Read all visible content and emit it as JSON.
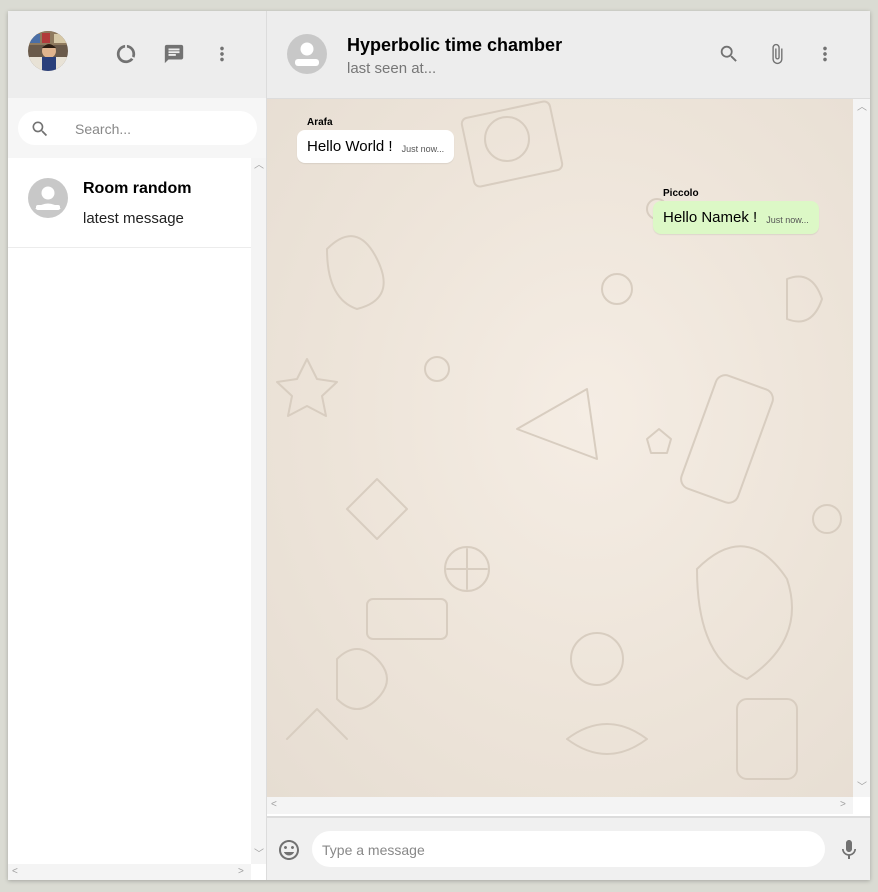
{
  "sidebar": {
    "header": {
      "user_avatar": "user-photo",
      "icons": [
        "status-icon",
        "chat-icon",
        "more-vert-icon"
      ]
    },
    "search": {
      "placeholder": "Search..."
    },
    "chats": [
      {
        "title": "Room random",
        "last_message": "latest message",
        "avatar": "person-icon"
      }
    ]
  },
  "main": {
    "header": {
      "title": "Hyperbolic time chamber",
      "subtitle": "last seen at...",
      "icons": [
        "search-icon",
        "attach-icon",
        "more-vert-icon"
      ]
    },
    "messages": [
      {
        "sender": "Arafa",
        "text": "Hello World !",
        "time": "Just now...",
        "mine": false
      },
      {
        "sender": "Piccolo",
        "text": "Hello Namek !",
        "time": "Just now...",
        "mine": true
      }
    ],
    "footer": {
      "placeholder": "Type a message",
      "icons": [
        "emoji-icon",
        "mic-icon"
      ]
    }
  },
  "colors": {
    "header_bg": "#ededed",
    "outgoing_bubble": "#dcf8c6",
    "incoming_bubble": "#ffffff",
    "page_bg": "#dadbd3"
  }
}
